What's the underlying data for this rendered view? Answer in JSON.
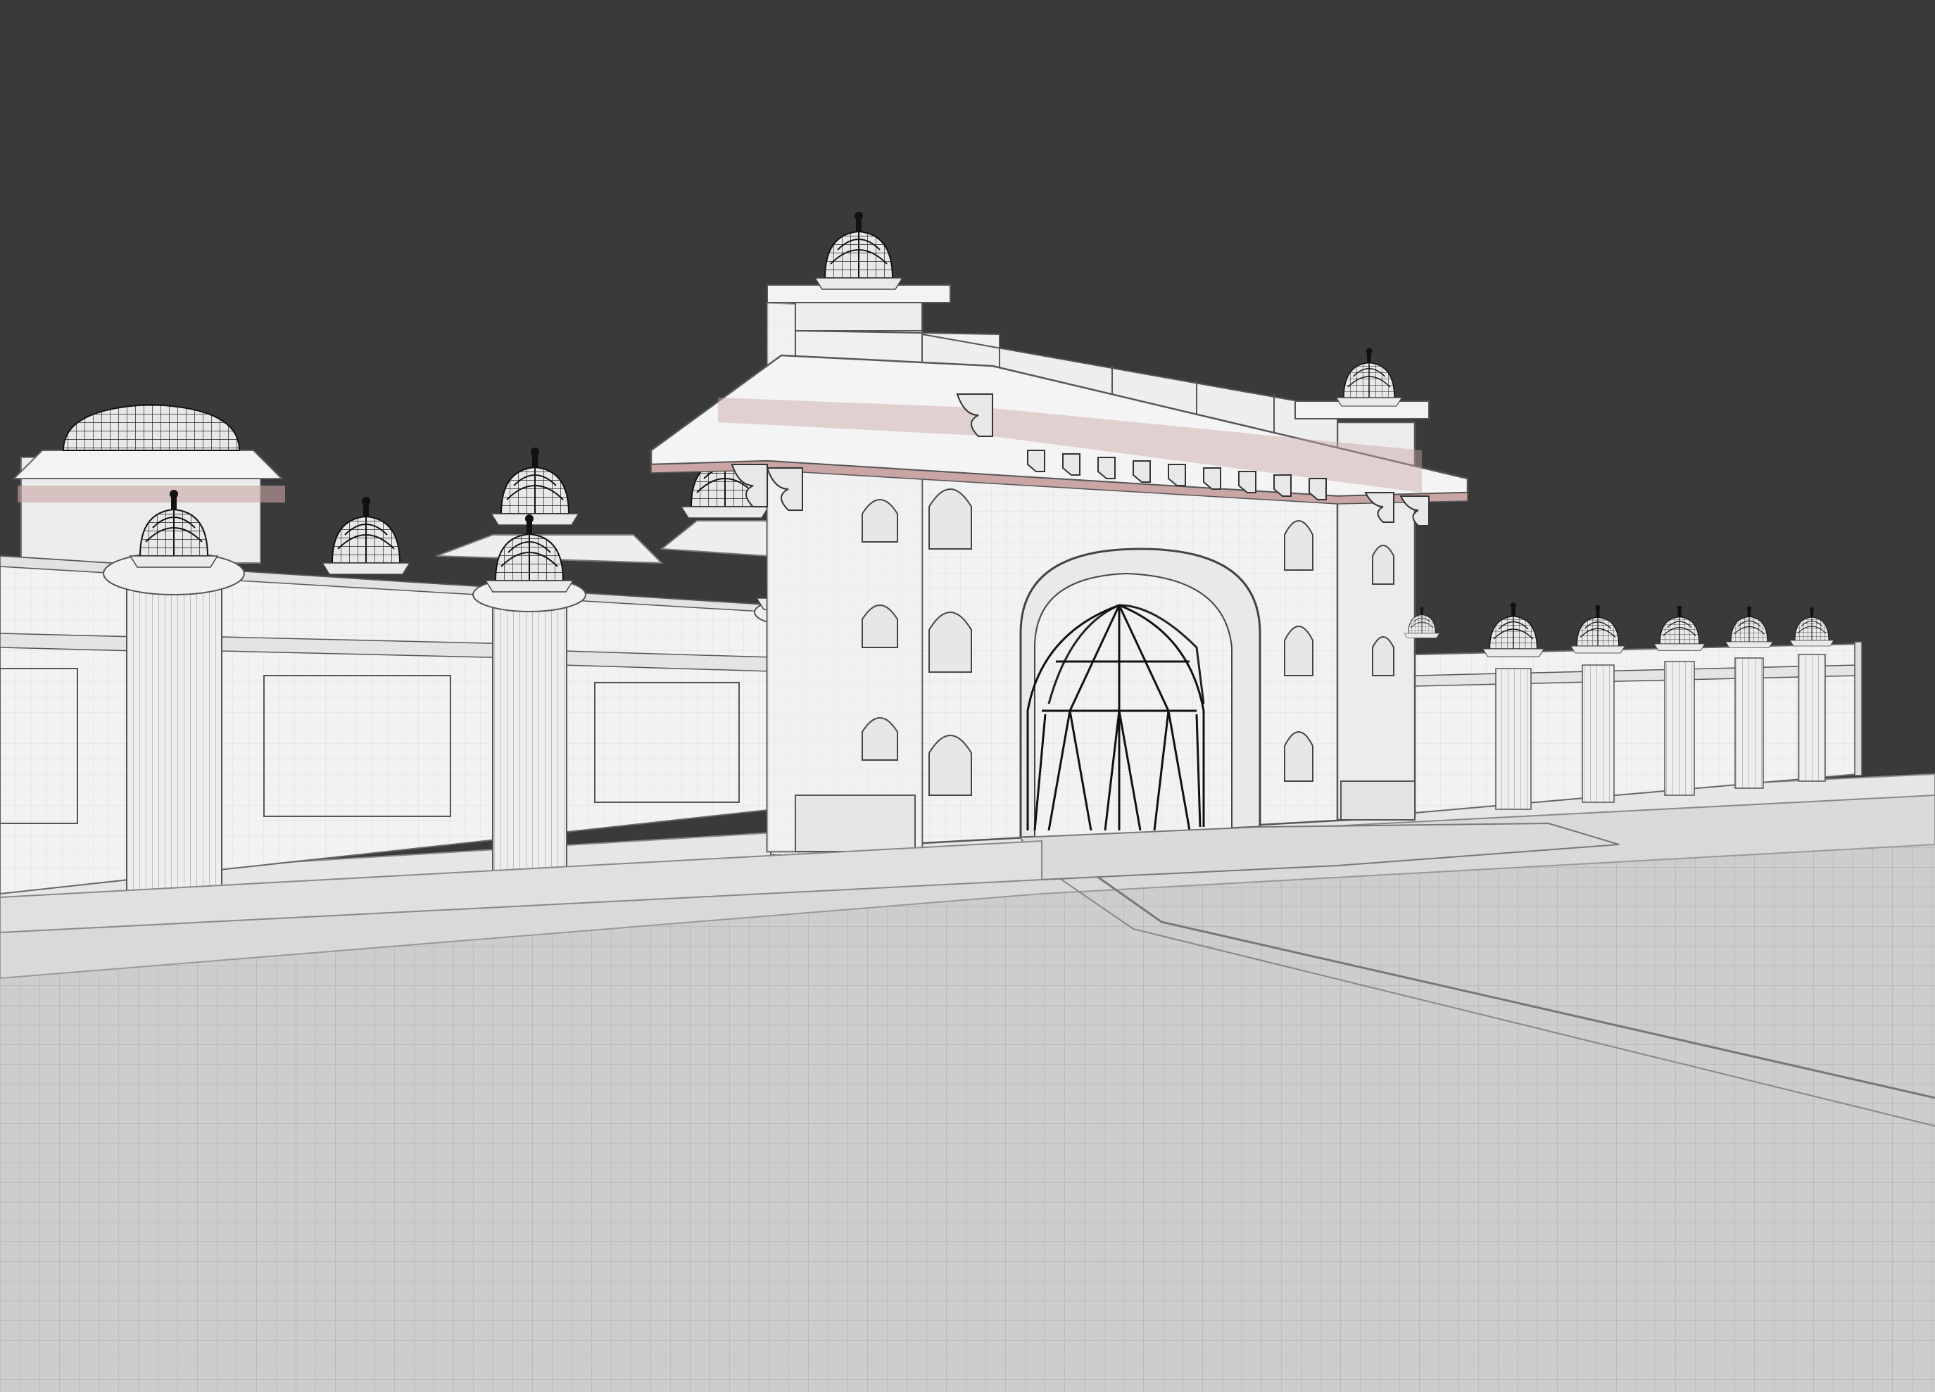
{
  "viewport": {
    "type": "3d-viewport",
    "shading": "solid-wireframe",
    "subject": "palace-gate-3d-model"
  },
  "colors": {
    "background": "#3a3a3a",
    "model_base": "#f0f0f0",
    "model_shade": "#d6d6d6",
    "soffit_accent": "#c9a5a5",
    "ground": "#cfcfcf",
    "wireframe": "#7a7a7a",
    "dome": "#1a1a1a"
  },
  "icons": [
    "dome-icon"
  ],
  "counts": {
    "right_wall_pillars": 5,
    "left_wall_pillars": 3,
    "gate_niches_per_side": 3
  }
}
